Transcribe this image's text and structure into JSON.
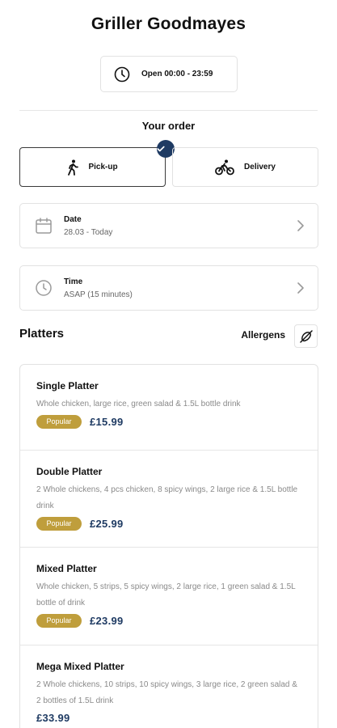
{
  "header": {
    "title": "Griller Goodmayes"
  },
  "hours": {
    "text": "Open 00:00 - 23:59",
    "icon": "clock-icon"
  },
  "order": {
    "title": "Your order",
    "modes": [
      {
        "label": "Pick-up",
        "selected": true,
        "icon": "walking-person-icon"
      },
      {
        "label": "Delivery",
        "selected": false,
        "icon": "bicycle-icon"
      }
    ],
    "date": {
      "label": "Date",
      "value": "28.03 - Today",
      "icon": "calendar-icon"
    },
    "time": {
      "label": "Time",
      "value": "ASAP (15 minutes)",
      "icon": "clock-icon"
    }
  },
  "menu": {
    "section": "Platters",
    "allergens_label": "Allergens",
    "accent": "#1f3b63",
    "badge_color": "#bf9e3c",
    "items": [
      {
        "name": "Single Platter",
        "desc": "Whole chicken, large rice, green salad & 1.5L bottle drink",
        "badge": "Popular",
        "price": "£15.99"
      },
      {
        "name": "Double Platter",
        "desc": "2 Whole chickens, 4 pcs chicken, 8 spicy wings, 2 large rice & 1.5L bottle drink",
        "badge": "Popular",
        "price": "£25.99"
      },
      {
        "name": "Mixed Platter",
        "desc": "Whole chicken, 5 strips, 5 spicy wings, 2 large rice, 1 green salad & 1.5L bottle of drink",
        "badge": "Popular",
        "price": "£23.99"
      },
      {
        "name": "Mega Mixed Platter",
        "desc": "2 Whole chickens, 10 strips, 10 spicy wings, 3 large rice, 2 green salad & 2 bottles of 1.5L drink",
        "badge": "",
        "price": "£33.99"
      }
    ]
  }
}
